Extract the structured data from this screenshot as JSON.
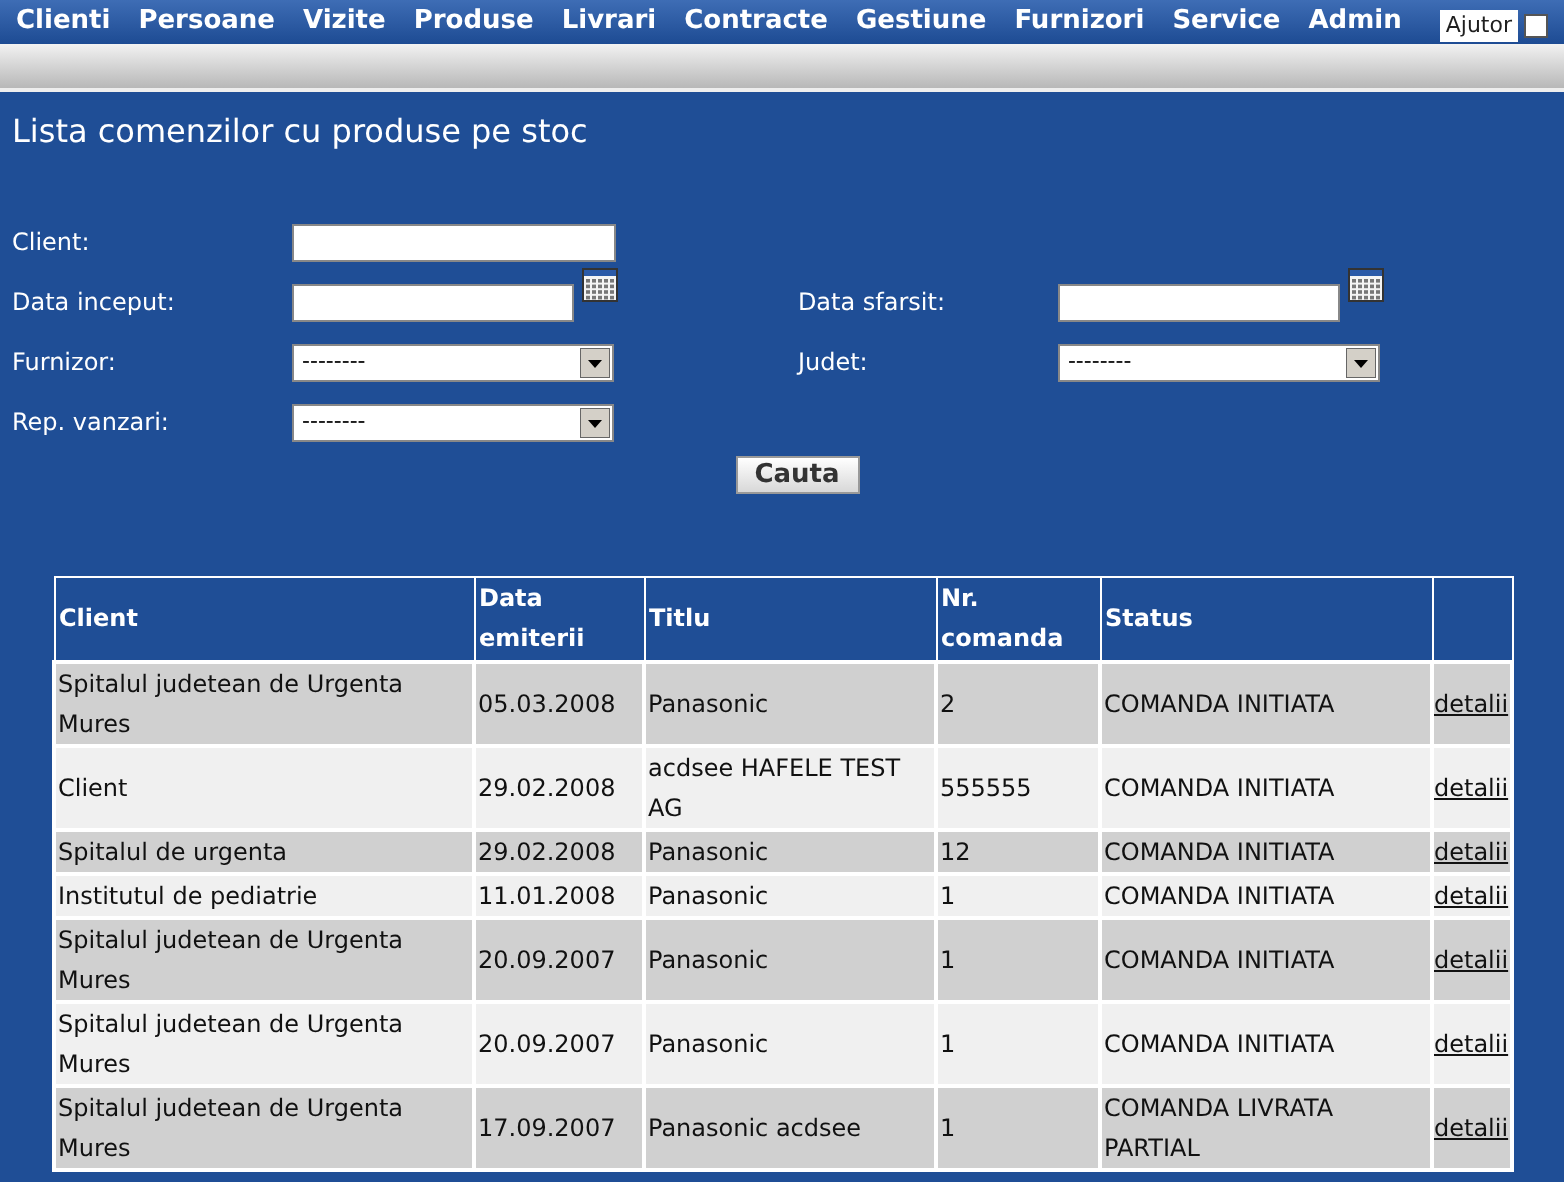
{
  "menu": [
    {
      "label": "Clienti"
    },
    {
      "label": "Persoane"
    },
    {
      "label": "Vizite"
    },
    {
      "label": "Produse"
    },
    {
      "label": "Livrari"
    },
    {
      "label": "Contracte"
    },
    {
      "label": "Gestiune"
    },
    {
      "label": "Furnizori"
    },
    {
      "label": "Service"
    },
    {
      "label": "Admin"
    }
  ],
  "help": {
    "label": "Ajutor",
    "checked": false
  },
  "title": "Lista comenzilor cu produse pe stoc",
  "filter_rows": [
    [
      {
        "kind": "text",
        "label": "Client:"
      }
    ],
    [
      {
        "kind": "date",
        "label": "Data inceput:"
      },
      {
        "kind": "date",
        "label": "Data sfarsit:"
      }
    ],
    [
      {
        "kind": "select",
        "label": "Furnizor:",
        "value": "--------"
      },
      {
        "kind": "select",
        "label": "Judet:",
        "value": "--------"
      }
    ],
    [
      {
        "kind": "select",
        "label": "Rep. vanzari:",
        "value": "--------"
      }
    ]
  ],
  "search_button": "Cauta",
  "table": {
    "columns": [
      "Client",
      "Data emiterii",
      "Titlu",
      "Nr. comanda",
      "Status"
    ],
    "rows": [
      {
        "client": "Spitalul judetean de Urgenta Mures",
        "date": "05.03.2008",
        "title": "Panasonic",
        "number": "2",
        "status": "COMANDA INITIATA",
        "link": "detalii"
      },
      {
        "client": "Client",
        "date": "29.02.2008",
        "title": "acdsee HAFELE TEST AG",
        "number": "555555",
        "status": "COMANDA INITIATA",
        "link": "detalii"
      },
      {
        "client": "Spitalul de urgenta",
        "date": "29.02.2008",
        "title": "Panasonic",
        "number": "12",
        "status": "COMANDA INITIATA",
        "link": "detalii"
      },
      {
        "client": "Institutul de pediatrie",
        "date": "11.01.2008",
        "title": "Panasonic",
        "number": "1",
        "status": "COMANDA INITIATA",
        "link": "detalii"
      },
      {
        "client": "Spitalul judetean de Urgenta Mures",
        "date": "20.09.2007",
        "title": "Panasonic",
        "number": "1",
        "status": "COMANDA INITIATA",
        "link": "detalii"
      },
      {
        "client": "Spitalul judetean de Urgenta Mures",
        "date": "20.09.2007",
        "title": "Panasonic",
        "number": "1",
        "status": "COMANDA INITIATA",
        "link": "detalii"
      },
      {
        "client": "Spitalul judetean de Urgenta Mures",
        "date": "17.09.2007",
        "title": "Panasonic acdsee",
        "number": "1",
        "status": "COMANDA LIVRATA PARTIAL",
        "link": "detalii"
      }
    ]
  }
}
